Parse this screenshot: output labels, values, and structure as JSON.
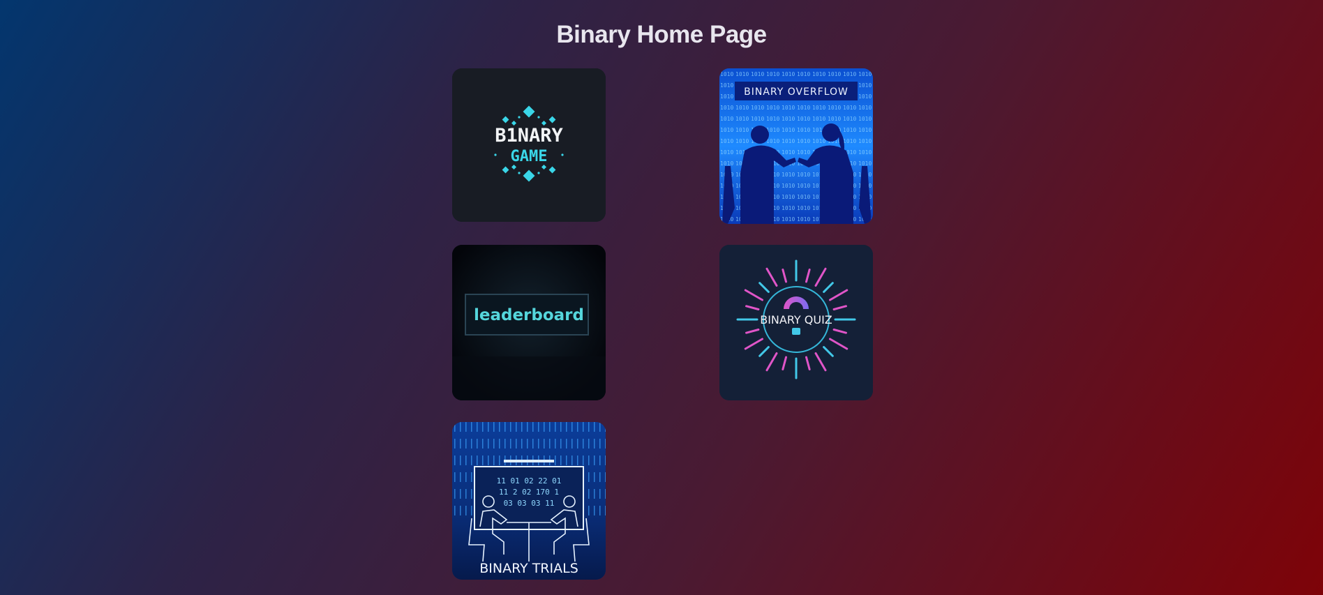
{
  "page": {
    "title": "Binary Home Page",
    "background_colors": [
      "#03366e",
      "#2c2347",
      "#4a1a32",
      "#7e0308"
    ]
  },
  "tiles": [
    {
      "line1": "B1NARY",
      "line2": "GAME",
      "icon": "binary-game-logo",
      "accent": "#3ad6e8"
    },
    {
      "label": "BINARY OVERFLOW",
      "icon": "binary-overflow-logo",
      "accent": "#1c7cf0"
    },
    {
      "label": "leaderboard",
      "icon": "leaderboard-logo",
      "accent": "#55d6dc"
    },
    {
      "label": "BINARY QUIZ",
      "icon": "binary-quiz-logo",
      "accent": "#e055c8"
    },
    {
      "label": "BINARY TRIALS",
      "icon": "binary-trials-logo",
      "accent": "#2f8fff"
    }
  ]
}
